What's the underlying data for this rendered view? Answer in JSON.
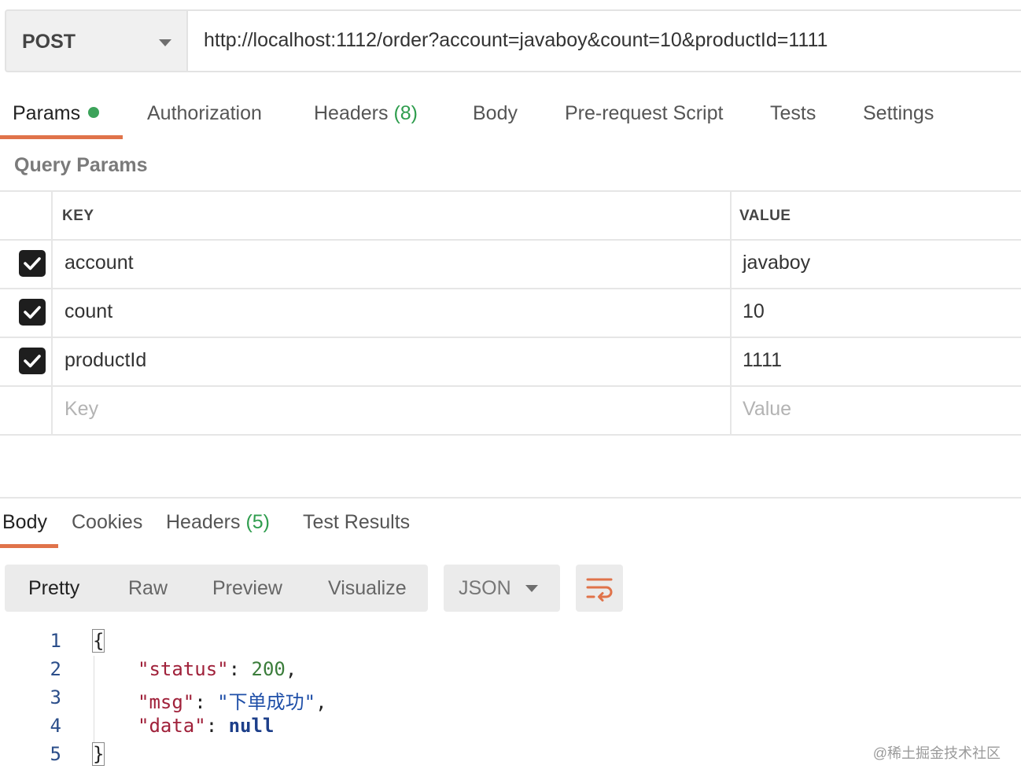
{
  "request": {
    "method": "POST",
    "url": "http://localhost:1112/order?account=javaboy&count=10&productId=1111"
  },
  "request_tabs": [
    {
      "label": "Params",
      "active": true
    },
    {
      "label": "Authorization"
    },
    {
      "label": "Headers",
      "count": "(8)"
    },
    {
      "label": "Body"
    },
    {
      "label": "Pre-request Script"
    },
    {
      "label": "Tests"
    },
    {
      "label": "Settings"
    }
  ],
  "query_params": {
    "title": "Query Params",
    "headers": [
      "KEY",
      "VALUE"
    ],
    "rows": [
      {
        "key": "account",
        "value": "javaboy",
        "checked": true
      },
      {
        "key": "count",
        "value": "10",
        "checked": true
      },
      {
        "key": "productId",
        "value": "1111",
        "checked": true
      }
    ],
    "new_row": {
      "key_placeholder": "Key",
      "value_placeholder": "Value"
    }
  },
  "response_tabs": [
    {
      "label": "Body",
      "active": true
    },
    {
      "label": "Cookies"
    },
    {
      "label": "Headers",
      "count": "(5)"
    },
    {
      "label": "Test Results"
    }
  ],
  "view_modes": [
    "Pretty",
    "Raw",
    "Preview",
    "Visualize"
  ],
  "active_view_mode": "Pretty",
  "format": "JSON",
  "wrap_icon": "text-wrap-icon",
  "code": {
    "line_numbers": [
      "1",
      "2",
      "3",
      "4",
      "5"
    ],
    "open_brace": "{",
    "close_brace": "}",
    "status_key": "\"status\"",
    "status_value": "200",
    "msg_key": "\"msg\"",
    "msg_value": "\"下单成功\"",
    "data_key": "\"data\"",
    "data_value": "null"
  },
  "watermark": "@稀土掘金技术社区",
  "colors": {
    "accent": "#e0734a",
    "params_dot": "#3ca35a",
    "json_key": "#a0213a",
    "json_number": "#3b7d3b",
    "json_string": "#1f4fa8"
  }
}
